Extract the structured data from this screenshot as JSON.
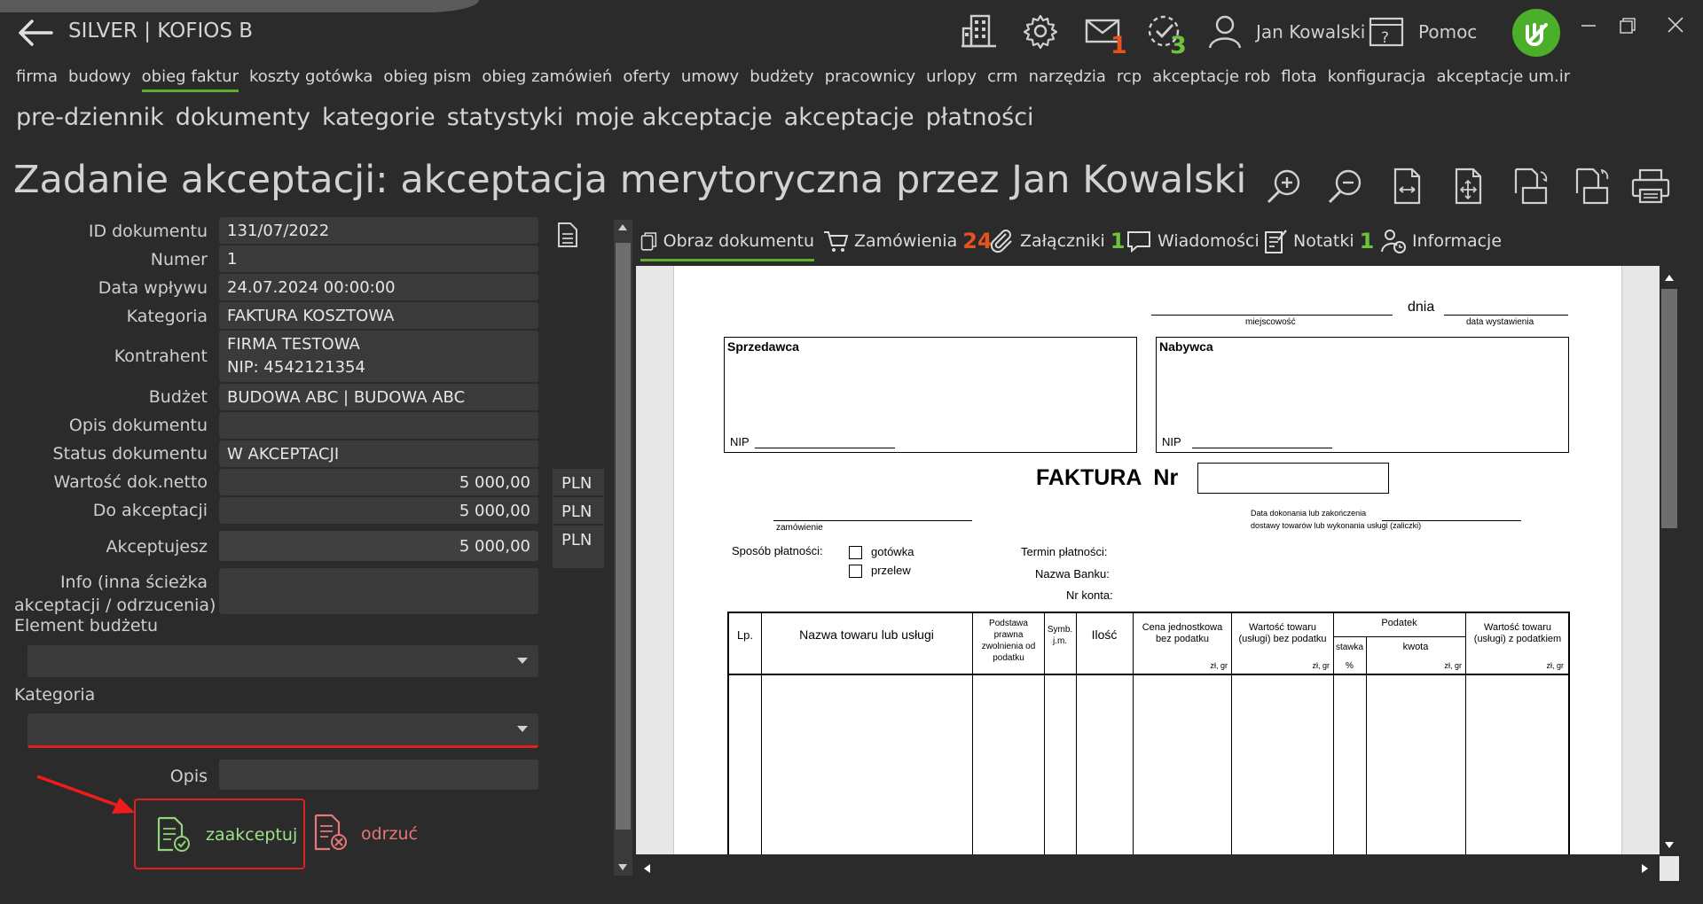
{
  "app": {
    "title": "SILVER | KOFIOS B",
    "user": "Jan Kowalski",
    "help": "Pomoc"
  },
  "topbar": {
    "mail_count": "1",
    "tasks_count": "3"
  },
  "main_menu": [
    "firma",
    "budowy",
    "obieg faktur",
    "koszty gotówka",
    "obieg pism",
    "obieg zamówień",
    "oferty",
    "umowy",
    "budżety",
    "pracownicy",
    "urlopy",
    "crm",
    "narzędzia",
    "rcp",
    "akceptacje rob",
    "flota",
    "konfiguracja",
    "akceptacje um.ir"
  ],
  "main_menu_active": "obieg faktur",
  "sub_menu": [
    "pre-dziennik",
    "dokumenty",
    "kategorie",
    "statystyki",
    "moje akceptacje",
    "akceptacje",
    "płatności"
  ],
  "page_title": "Zadanie akceptacji: akceptacja merytoryczna przez Jan Kowalski",
  "form": {
    "id_label": "ID dokumentu",
    "id_value": "131/07/2022",
    "number_label": "Numer",
    "number_value": "1",
    "date_label": "Data wpływu",
    "date_value": "24.07.2024 00:00:00",
    "category_label": "Kategoria",
    "category_value": "FAKTURA KOSZTOWA",
    "contractor_label": "Kontrahent",
    "contractor_name": "FIRMA TESTOWA",
    "contractor_nip": "NIP: 4542121354",
    "budget_label": "Budżet",
    "budget_value": "BUDOWA ABC | BUDOWA ABC",
    "desc_label": "Opis dokumentu",
    "desc_value": "",
    "status_label": "Status dokumentu",
    "status_value": "W AKCEPTACJI",
    "net_label": "Wartość dok.netto",
    "net_value": "5 000,00",
    "net_currency": "PLN",
    "to_accept_label": "Do akceptacji",
    "to_accept_value": "5 000,00",
    "to_accept_currency": "PLN",
    "accepting_label": "Akceptujesz",
    "accepting_value": "5 000,00",
    "accepting_currency": "PLN",
    "info_label_1": "Info (inna ścieżka",
    "info_label_2": "akceptacji / odrzucenia)",
    "budget_element_label": "Element budżetu",
    "category2_label": "Kategoria",
    "note_label": "Opis"
  },
  "actions": {
    "accept": "zaakceptuj",
    "reject": "odrzuć"
  },
  "tabs": {
    "image": "Obraz dokumentu",
    "orders": "Zamówienia",
    "orders_count": "24",
    "attachments": "Załączniki",
    "attachments_count": "1",
    "messages": "Wiadomości",
    "notes": "Notatki",
    "notes_count": "1",
    "info": "Informacje"
  },
  "invoice": {
    "dnia": "dnia",
    "place": "miejscowość",
    "issue_date": "data wystawienia",
    "seller": "Sprzedawca",
    "buyer": "Nabywca",
    "nip": "NIP",
    "nip_buyer": "NIP",
    "title": "FAKTURA  Nr",
    "order": "zamówienie",
    "delivery_1": "Data dokonania lub zakończenia",
    "delivery_2": "dostawy towarów lub wykonania usługi (zaliczki)",
    "payment": "Sposób płatności:",
    "cash": "gotówka",
    "transfer": "przelew",
    "due": "Termin płatności:",
    "bank": "Nazwa Banku:",
    "account": "Nr konta:",
    "col_lp": "Lp.",
    "col_name": "Nazwa towaru lub usługi",
    "col_basis": "Podstawa prawna zwolnienia od podatku",
    "col_symb": "Symb. j.m.",
    "col_qty": "Ilość",
    "col_price": "Cena jednostkowa bez podatku",
    "col_value_net": "Wartość towaru (usługi) bez podatku",
    "col_tax": "Podatek",
    "col_rate": "stawka",
    "col_pct": "%",
    "col_amount": "kwota",
    "col_value_gross": "Wartość towaru (usługi) z podatkiem",
    "zl_gr": "zł,   gr"
  }
}
